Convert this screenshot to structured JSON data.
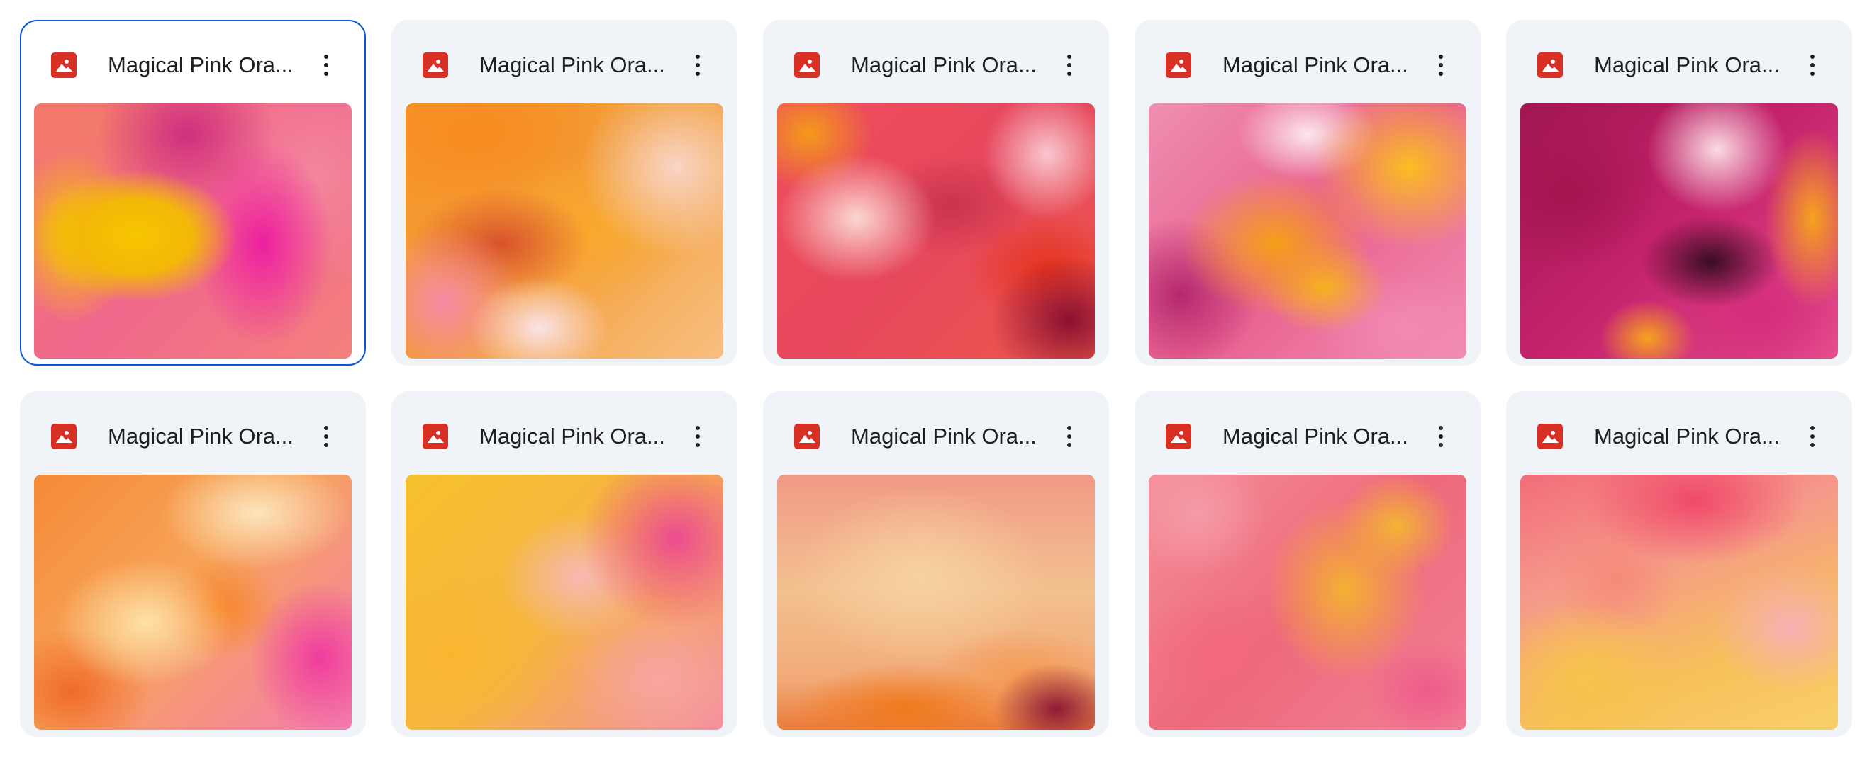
{
  "colors": {
    "card_background": "#f0f4f9",
    "selected_border": "#0b57d0",
    "image_icon": "#d93025",
    "text": "#1f1f1f"
  },
  "grid": {
    "files": [
      {
        "name": "Magical Pink Ora...",
        "icon": "image-icon",
        "selected": true
      },
      {
        "name": "Magical Pink Ora...",
        "icon": "image-icon",
        "selected": false
      },
      {
        "name": "Magical Pink Ora...",
        "icon": "image-icon",
        "selected": false
      },
      {
        "name": "Magical Pink Ora...",
        "icon": "image-icon",
        "selected": false
      },
      {
        "name": "Magical Pink Ora...",
        "icon": "image-icon",
        "selected": false
      },
      {
        "name": "Magical Pink Ora...",
        "icon": "image-icon",
        "selected": false
      },
      {
        "name": "Magical Pink Ora...",
        "icon": "image-icon",
        "selected": false
      },
      {
        "name": "Magical Pink Ora...",
        "icon": "image-icon",
        "selected": false
      },
      {
        "name": "Magical Pink Ora...",
        "icon": "image-icon",
        "selected": false
      },
      {
        "name": "Magical Pink Ora...",
        "icon": "image-icon",
        "selected": false
      }
    ]
  }
}
